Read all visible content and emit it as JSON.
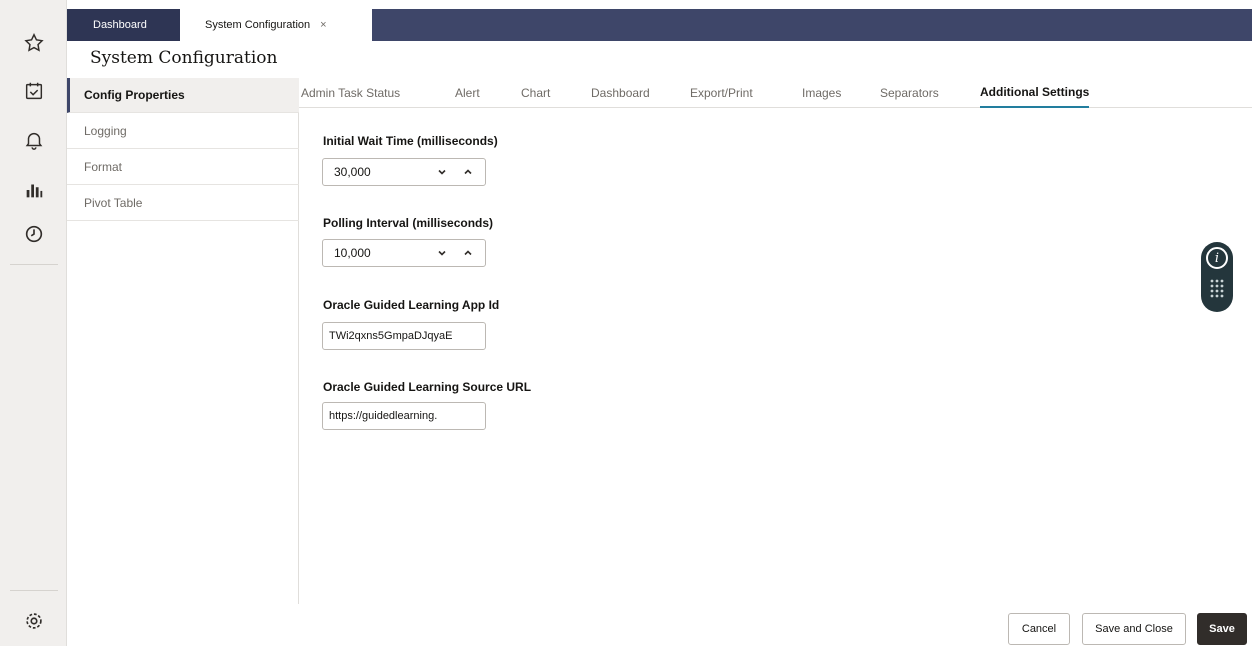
{
  "rail": {
    "icons": [
      "star-icon",
      "calendar-check-icon",
      "bell-icon",
      "bar-chart-icon",
      "clock-icon",
      "gear-icon"
    ]
  },
  "tabs": {
    "dashboard_label": "Dashboard",
    "system_config_label": "System Configuration",
    "close_glyph": "×"
  },
  "page": {
    "title": "System Configuration"
  },
  "left_nav": {
    "items": [
      {
        "label": "Config Properties",
        "active": true
      },
      {
        "label": "Logging",
        "active": false
      },
      {
        "label": "Format",
        "active": false
      },
      {
        "label": "Pivot Table",
        "active": false
      }
    ]
  },
  "sub_tabs": {
    "items": [
      {
        "label": "Admin Task Status",
        "active": false
      },
      {
        "label": "Alert",
        "active": false
      },
      {
        "label": "Chart",
        "active": false
      },
      {
        "label": "Dashboard",
        "active": false
      },
      {
        "label": "Export/Print",
        "active": false
      },
      {
        "label": "Images",
        "active": false
      },
      {
        "label": "Separators",
        "active": false
      },
      {
        "label": "Additional Settings",
        "active": true
      }
    ]
  },
  "form": {
    "initial_wait": {
      "label": "Initial Wait Time (milliseconds)",
      "value": "30,000"
    },
    "polling_interval": {
      "label": "Polling Interval (milliseconds)",
      "value": "10,000"
    },
    "ogl_app_id": {
      "label": "Oracle Guided Learning App Id",
      "value": "TWi2qxns5GmpaDJqyaE"
    },
    "ogl_source_url": {
      "label": "Oracle Guided Learning Source URL",
      "value": "https://guidedlearning."
    }
  },
  "help_widget": {
    "icon": "info-icon",
    "dots_icon": "keypad-dots-icon"
  },
  "actions": {
    "cancel_label": "Cancel",
    "save_close_label": "Save and Close",
    "save_label": "Save"
  },
  "colors": {
    "tabbar": "#3e4669",
    "active_underline": "#227e9e",
    "primary_button": "#312d2a",
    "help_widget": "#24363c"
  }
}
